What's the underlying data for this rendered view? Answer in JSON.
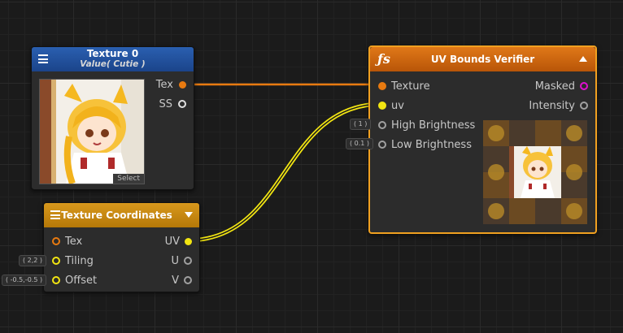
{
  "canvas": {
    "background": "#1b1b1b"
  },
  "texture0": {
    "title": "Texture 0",
    "subtitle": "Value( Cutie )",
    "outputs": [
      {
        "label": "Tex"
      },
      {
        "label": "SS"
      }
    ],
    "select_label": "Select",
    "header_color": "#1f4f9c"
  },
  "texcoord": {
    "title": "Texture Coordinates",
    "inputs": [
      {
        "label": "Tex"
      },
      {
        "label": "Tiling"
      },
      {
        "label": "Offset"
      }
    ],
    "outputs": [
      {
        "label": "UV"
      },
      {
        "label": "U"
      },
      {
        "label": "V"
      }
    ],
    "badges": {
      "tiling": "( 2,2 )",
      "offset": "( -0.5,-0.5 )"
    },
    "header_color": "#c78a12"
  },
  "uvnode": {
    "title": "UV Bounds Verifier",
    "fx_icon": "ƒs",
    "inputs": [
      {
        "label": "Texture"
      },
      {
        "label": "uv"
      },
      {
        "label": "High Brightness"
      },
      {
        "label": "Low Brightness"
      }
    ],
    "outputs": [
      {
        "label": "Masked"
      },
      {
        "label": "Intensity"
      }
    ],
    "badges": {
      "high": "( 1 )",
      "low": "( 0.1 )"
    },
    "header_color": "#d46a10",
    "selected_color": "#f0a020"
  },
  "colors": {
    "texture_wire": "#e87a10",
    "uv_wire": "#f2e512",
    "magenta_port": "#e010d0"
  }
}
